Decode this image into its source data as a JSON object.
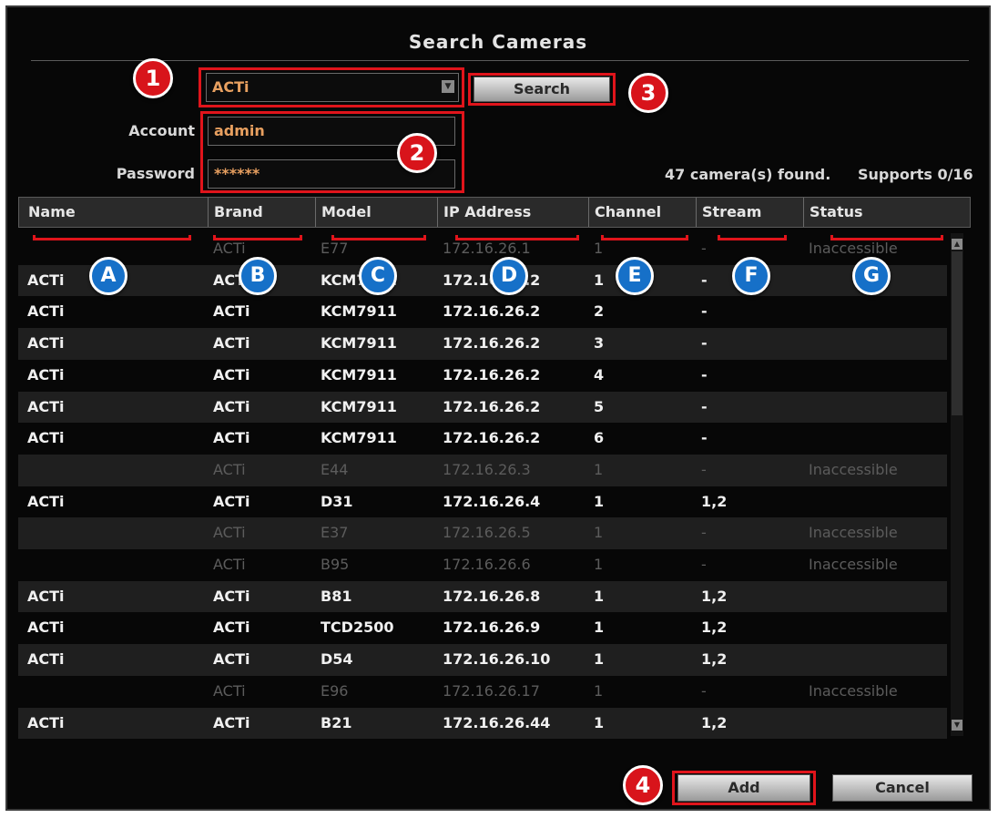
{
  "dialog": {
    "title": "Search Cameras"
  },
  "form": {
    "brand_value": "ACTi",
    "search_label": "Search",
    "account_label": "Account",
    "account_value": "admin",
    "password_label": "Password",
    "password_value": "******"
  },
  "status": {
    "found": "47 camera(s) found.",
    "supports": "Supports 0/16"
  },
  "table": {
    "headers": [
      "Name",
      "Brand",
      "Model",
      "IP Address",
      "Channel",
      "Stream",
      "Status"
    ],
    "rows": [
      {
        "name": "",
        "brand": "ACTi",
        "model": "E77",
        "ip": "172.16.26.1",
        "channel": "1",
        "stream": "-",
        "status": "Inaccessible",
        "dim": true
      },
      {
        "name": "ACTi",
        "brand": "ACTi",
        "model": "KCM7911",
        "ip": "172.16.26.2",
        "channel": "1",
        "stream": "-",
        "status": "",
        "dim": false
      },
      {
        "name": "ACTi",
        "brand": "ACTi",
        "model": "KCM7911",
        "ip": "172.16.26.2",
        "channel": "2",
        "stream": "-",
        "status": "",
        "dim": false
      },
      {
        "name": "ACTi",
        "brand": "ACTi",
        "model": "KCM7911",
        "ip": "172.16.26.2",
        "channel": "3",
        "stream": "-",
        "status": "",
        "dim": false
      },
      {
        "name": "ACTi",
        "brand": "ACTi",
        "model": "KCM7911",
        "ip": "172.16.26.2",
        "channel": "4",
        "stream": "-",
        "status": "",
        "dim": false
      },
      {
        "name": "ACTi",
        "brand": "ACTi",
        "model": "KCM7911",
        "ip": "172.16.26.2",
        "channel": "5",
        "stream": "-",
        "status": "",
        "dim": false
      },
      {
        "name": "ACTi",
        "brand": "ACTi",
        "model": "KCM7911",
        "ip": "172.16.26.2",
        "channel": "6",
        "stream": "-",
        "status": "",
        "dim": false
      },
      {
        "name": "",
        "brand": "ACTi",
        "model": "E44",
        "ip": "172.16.26.3",
        "channel": "1",
        "stream": "-",
        "status": "Inaccessible",
        "dim": true
      },
      {
        "name": "ACTi",
        "brand": "ACTi",
        "model": "D31",
        "ip": "172.16.26.4",
        "channel": "1",
        "stream": "1,2",
        "status": "",
        "dim": false
      },
      {
        "name": "",
        "brand": "ACTi",
        "model": "E37",
        "ip": "172.16.26.5",
        "channel": "1",
        "stream": "-",
        "status": "Inaccessible",
        "dim": true
      },
      {
        "name": "",
        "brand": "ACTi",
        "model": "B95",
        "ip": "172.16.26.6",
        "channel": "1",
        "stream": "-",
        "status": "Inaccessible",
        "dim": true
      },
      {
        "name": "ACTi",
        "brand": "ACTi",
        "model": "B81",
        "ip": "172.16.26.8",
        "channel": "1",
        "stream": "1,2",
        "status": "",
        "dim": false
      },
      {
        "name": "ACTi",
        "brand": "ACTi",
        "model": "TCD2500",
        "ip": "172.16.26.9",
        "channel": "1",
        "stream": "1,2",
        "status": "",
        "dim": false
      },
      {
        "name": "ACTi",
        "brand": "ACTi",
        "model": "D54",
        "ip": "172.16.26.10",
        "channel": "1",
        "stream": "1,2",
        "status": "",
        "dim": false
      },
      {
        "name": "",
        "brand": "ACTi",
        "model": "E96",
        "ip": "172.16.26.17",
        "channel": "1",
        "stream": "-",
        "status": "Inaccessible",
        "dim": true
      },
      {
        "name": "ACTi",
        "brand": "ACTi",
        "model": "B21",
        "ip": "172.16.26.44",
        "channel": "1",
        "stream": "1,2",
        "status": "",
        "dim": false
      }
    ]
  },
  "footer": {
    "add_label": "Add",
    "cancel_label": "Cancel"
  },
  "callouts": {
    "numbers": [
      "1",
      "2",
      "3",
      "4"
    ],
    "letters": [
      "A",
      "B",
      "C",
      "D",
      "E",
      "F",
      "G"
    ]
  },
  "colors": {
    "highlight": "#e0141b",
    "number_marker": "#d8141b",
    "letter_marker": "#1670c8",
    "field_text": "#e8a060"
  },
  "icons": {
    "dropdown": "chevron-down-icon",
    "scroll_up": "arrow-up-icon",
    "scroll_down": "arrow-down-icon"
  }
}
